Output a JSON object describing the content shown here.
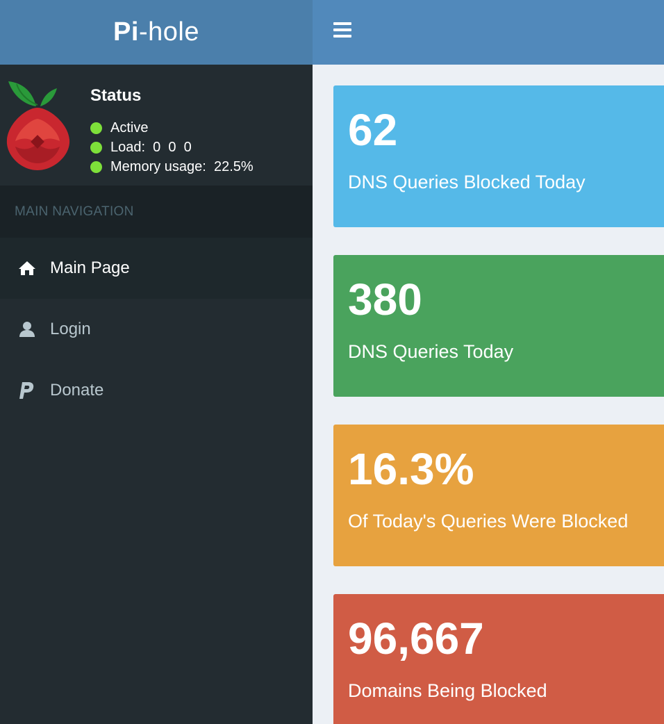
{
  "header": {
    "logo_bold": "Pi",
    "logo_rest": "-hole"
  },
  "sidebar": {
    "status": {
      "title": "Status",
      "lines": [
        {
          "text": "Active",
          "indicator": "#7ee03a"
        },
        {
          "text": "Load:  0  0  0",
          "indicator": "#7ee03a"
        },
        {
          "text": "Memory usage:  22.5%",
          "indicator": "#7ee03a"
        }
      ]
    },
    "nav_header": "MAIN NAVIGATION",
    "items": [
      {
        "label": "Main Page",
        "icon": "home-icon",
        "active": true
      },
      {
        "label": "Login",
        "icon": "user-icon",
        "active": false
      },
      {
        "label": "Donate",
        "icon": "paypal-icon",
        "active": false
      }
    ]
  },
  "stats": [
    {
      "value": "62",
      "label": "DNS Queries Blocked Today",
      "color": "#55b9e8"
    },
    {
      "value": "380",
      "label": "DNS Queries Today",
      "color": "#4aa35d"
    },
    {
      "value": "16.3%",
      "label": "Of Today's Queries Were Blocked",
      "color": "#e7a23f"
    },
    {
      "value": "96,667",
      "label": "Domains Being Blocked",
      "color": "#d05c45"
    }
  ]
}
